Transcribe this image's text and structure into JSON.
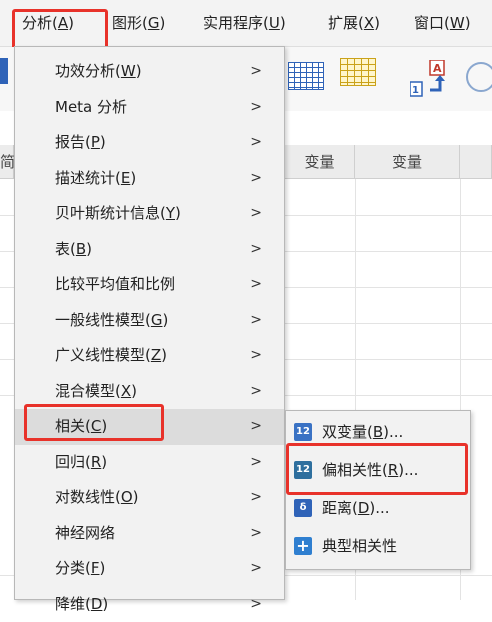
{
  "menubar": {
    "items": [
      {
        "label": "分析(",
        "key": "A",
        "tail": ")"
      },
      {
        "label": "图形(",
        "key": "G",
        "tail": ")"
      },
      {
        "label": "实用程序(",
        "key": "U",
        "tail": ")"
      },
      {
        "label": "扩展(",
        "key": "X",
        "tail": ")"
      },
      {
        "label": "窗口(",
        "key": "W",
        "tail": ")"
      }
    ]
  },
  "grid": {
    "row_header_fragment": "简",
    "columns": [
      "变量",
      "变量"
    ]
  },
  "menu": {
    "items": [
      {
        "label": "功效分析(",
        "key": "W",
        "tail": ")"
      },
      {
        "label": "Meta 分析",
        "key": "",
        "tail": ""
      },
      {
        "label": "报告(",
        "key": "P",
        "tail": ")"
      },
      {
        "label": "描述统计(",
        "key": "E",
        "tail": ")"
      },
      {
        "label": "贝叶斯统计信息(",
        "key": "Y",
        "tail": ")"
      },
      {
        "label": "表(",
        "key": "B",
        "tail": ")"
      },
      {
        "label": "比较平均值和比例",
        "key": "",
        "tail": ""
      },
      {
        "label": "一般线性模型(",
        "key": "G",
        "tail": ")"
      },
      {
        "label": "广义线性模型(",
        "key": "Z",
        "tail": ")"
      },
      {
        "label": "混合模型(",
        "key": "X",
        "tail": ")"
      },
      {
        "label": "相关(",
        "key": "C",
        "tail": ")"
      },
      {
        "label": "回归(",
        "key": "R",
        "tail": ")"
      },
      {
        "label": "对数线性(",
        "key": "O",
        "tail": ")"
      },
      {
        "label": "神经网络",
        "key": "",
        "tail": ""
      },
      {
        "label": "分类(",
        "key": "F",
        "tail": ")"
      },
      {
        "label": "降维(",
        "key": "D",
        "tail": ")"
      }
    ],
    "arrow": ">"
  },
  "submenu": {
    "items": [
      {
        "label": "双变量(",
        "key": "B",
        "tail": ")...",
        "icon": "bivariate-icon"
      },
      {
        "label": "偏相关性(",
        "key": "R",
        "tail": ")...",
        "icon": "partial-correlation-icon"
      },
      {
        "label": "距离(",
        "key": "D",
        "tail": ")...",
        "icon": "distance-icon"
      },
      {
        "label": "典型相关性",
        "key": "",
        "tail": "",
        "icon": "canonical-correlation-icon"
      }
    ],
    "icon_texts": [
      "12",
      "12",
      "δ",
      "+"
    ]
  },
  "colors": {
    "highlight": "#e8322a",
    "menu_bg": "#f2f2f2",
    "active_bg": "#dcdcdc"
  }
}
